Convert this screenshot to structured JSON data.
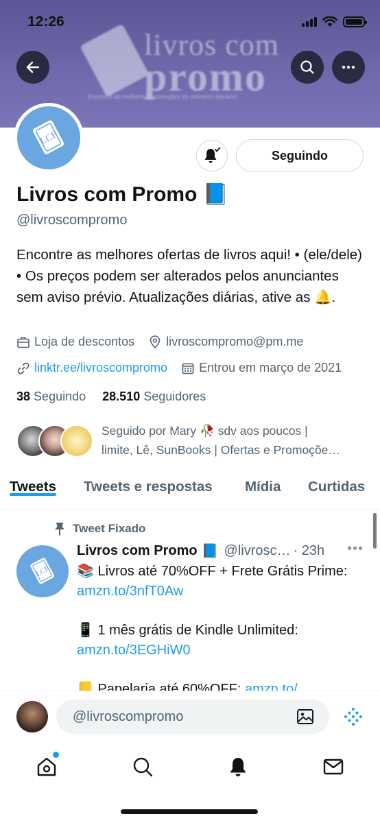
{
  "status_bar": {
    "time": "12:26"
  },
  "banner": {
    "logo_line1": "livros com",
    "logo_line2": "promo",
    "tagline": "Encontre as melhores promoções do universo literário!"
  },
  "profile": {
    "name": "Livros com Promo",
    "name_emoji": "📘",
    "handle": "@livroscompromo",
    "follow_button": "Seguindo",
    "bio": "Encontre as melhores ofertas de livros aqui! • (ele/dele) • Os preços podem ser alterados pelos anunciantes sem aviso prévio. Atualizações diárias, ative as 🔔.",
    "category": "Loja de descontos",
    "email": "livroscompromo@pm.me",
    "website": "linktr.ee/livroscompromo",
    "joined": "Entrou em março de 2021",
    "following_count": "38",
    "following_label": "Seguindo",
    "followers_count": "28.510",
    "followers_label": "Seguidores",
    "followed_by_line1": "Seguido por Mary 🥀 sdv aos poucos |",
    "followed_by_line2": "limite, Lê, SunBooks | Ofertas e Promoçõe…"
  },
  "tabs": [
    {
      "label": "Tweets",
      "active": true
    },
    {
      "label": "Tweets e respostas",
      "active": false
    },
    {
      "label": "Mídia",
      "active": false
    },
    {
      "label": "Curtidas",
      "active": false
    }
  ],
  "pinned_tweet": {
    "pinned_label": "Tweet Fixado",
    "author_name": "Livros com Promo",
    "author_emoji": "📘",
    "author_handle": "@livrosc…",
    "time": "· 23h",
    "line1_text": "📚 Livros até 70%OFF + Frete Grátis Prime: ",
    "line1_link": "amzn.to/3nfT0Aw",
    "line2_text": "📱 1 mês grátis de Kindle Unlimited: ",
    "line2_link": "amzn.to/3EGHiW0",
    "line3_text": "📒 Papelaria até 60%OFF: ",
    "line3_link": "amzn.to/"
  },
  "composer": {
    "placeholder": "@livroscompromo"
  },
  "colors": {
    "accent": "#1d9bf0",
    "avatar_blue": "#6aa6e0",
    "banner": "#6d69aa"
  }
}
